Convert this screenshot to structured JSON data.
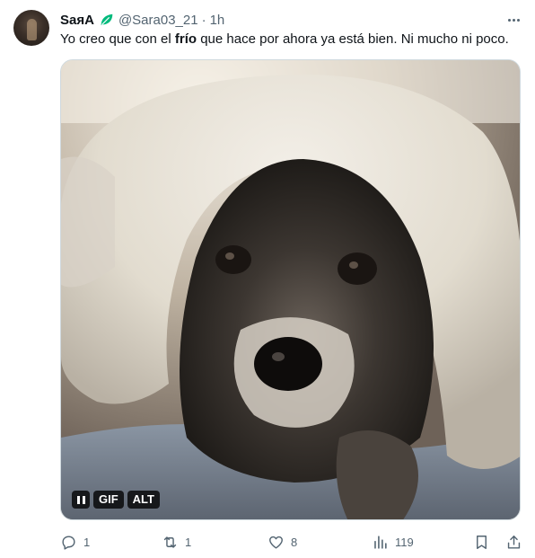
{
  "author": {
    "display_name": "SaяA",
    "badge_icon": "leaf-icon",
    "handle": "@Sara03_21",
    "separator": "·",
    "time": "1h"
  },
  "tweet": {
    "text_before": "Yo creo que con el ",
    "text_bold": "frío",
    "text_after": " que hace por ahora ya está bien. Ni mucho ni poco."
  },
  "media": {
    "kind": "gif",
    "badges": {
      "gif": "GIF",
      "alt": "ALT"
    }
  },
  "actions": {
    "reply": {
      "icon": "reply-icon",
      "count": "1"
    },
    "retweet": {
      "icon": "retweet-icon",
      "count": "1"
    },
    "like": {
      "icon": "heart-icon",
      "count": "8"
    },
    "views": {
      "icon": "views-icon",
      "count": "119"
    },
    "bookmark": {
      "icon": "bookmark-icon"
    },
    "share": {
      "icon": "share-icon"
    }
  },
  "colors": {
    "text": "#0f1419",
    "secondary": "#536471",
    "leaf": "#00ba7c",
    "border": "#cfd9de"
  }
}
